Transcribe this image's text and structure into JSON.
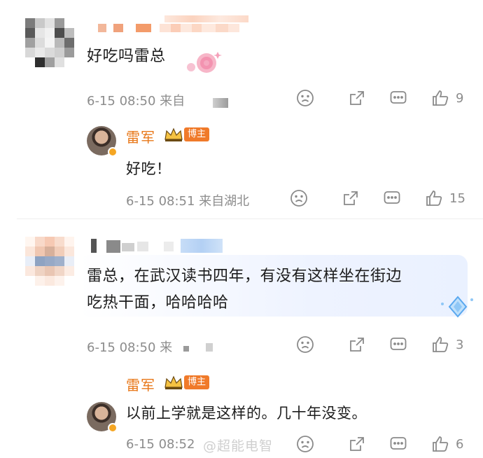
{
  "comments": [
    {
      "text": "好吃吗雷总",
      "meta": "6-15 08:50  来自",
      "like_count": "9",
      "reply": {
        "username": "雷军",
        "badge": "博主",
        "text": "好吃！",
        "meta": "6-15 08:51  来自湖北",
        "like_count": "15"
      }
    },
    {
      "text_line1": "雷总，在武汉读书四年，有没有这样坐在街边",
      "text_line2": "吃热干面，哈哈哈哈",
      "meta": "6-15 08:50  来",
      "like_count": "3",
      "reply": {
        "username": "雷军",
        "badge": "博主",
        "text": "以前上学就是这样的。几十年没变。",
        "meta": "6-15 08:52",
        "like_count": "6"
      }
    }
  ],
  "watermark": "@超能电智",
  "colors": {
    "username": "#e8781a",
    "badge_bg": "#f07a2a",
    "meta": "#8c8c8c",
    "icon": "#8a8a8a"
  },
  "icons": [
    "sad-face-icon",
    "share-icon",
    "comment-icon",
    "thumbs-up-icon",
    "crown-badge-icon",
    "verified-badge-icon"
  ]
}
